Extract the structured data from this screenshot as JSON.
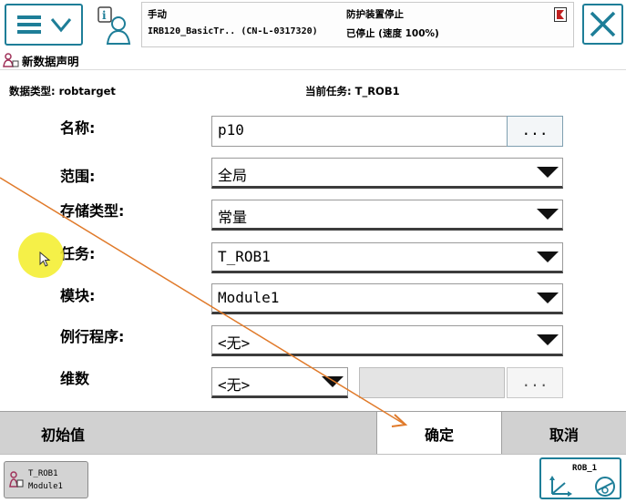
{
  "topbar": {
    "mode": "手动",
    "controller": "IRB120_BasicTr.. (CN-L-0317320)",
    "safety": "防护装置停止",
    "state": "已停止 (速度 100%)"
  },
  "header": {
    "title": "新数据声明"
  },
  "info": {
    "datatype_label": "数据类型: robtarget",
    "task_label": "当前任务:  T_ROB1"
  },
  "form": {
    "name_label": "名称:",
    "name_value": "p10",
    "name_button": "...",
    "scope_label": "范围:",
    "scope_value": "全局",
    "storage_label": "存储类型:",
    "storage_value": "常量",
    "task_label": "任务:",
    "task_value": "T_ROB1",
    "module_label": "模块:",
    "module_value": "Module1",
    "routine_label": "例行程序:",
    "routine_value": "<无>",
    "dim_label": "维数",
    "dim_value": "<无>",
    "dim_button": "..."
  },
  "bottom": {
    "initial_value": "初始值",
    "ok": "确定",
    "cancel": "取消"
  },
  "taskbar": {
    "item_line1": "T_ROB1",
    "item_line2": "Module1",
    "robot_label": "ROB_1"
  },
  "colors": {
    "accent": "#1e7e98",
    "bar": "#d1d1d1",
    "highlight": "#f4ee34",
    "pointer_line": "#e07a2a"
  }
}
